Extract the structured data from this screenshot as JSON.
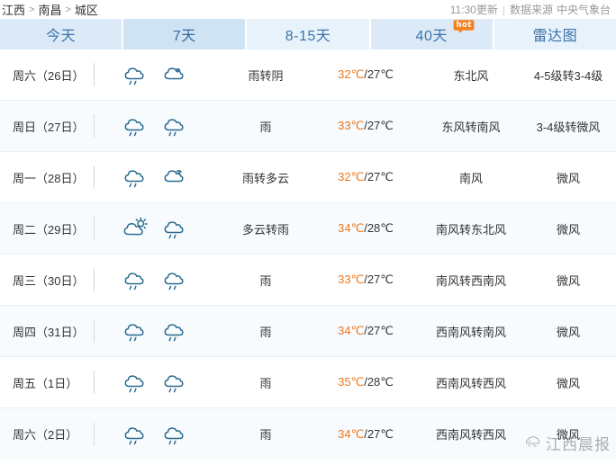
{
  "header": {
    "breadcrumb": [
      "江西",
      "南昌",
      "城区"
    ],
    "separator": ">",
    "update_time": "11:30更新",
    "divider": "|",
    "source_label": "数据来源",
    "source_name": "中央气象台"
  },
  "tabs": [
    {
      "label": "今天",
      "active": false,
      "style": "normal",
      "badge": null
    },
    {
      "label": "7天",
      "active": true,
      "style": "normal",
      "badge": null
    },
    {
      "label": "8-15天",
      "active": false,
      "style": "light",
      "badge": null
    },
    {
      "label": "40天",
      "active": false,
      "style": "normal",
      "badge": "hot"
    },
    {
      "label": "雷达图",
      "active": false,
      "style": "light",
      "badge": null
    }
  ],
  "colors": {
    "tab_bg": "#dceaf7",
    "tab_active_bg": "#cfe3f5",
    "tab_light_bg": "#e8f2fb",
    "tab_text": "#3b73a8",
    "hot_badge": "#f4811f",
    "high_temp": "#f0761a",
    "low_temp": "#333333",
    "icon": "#2a6b8f",
    "row_alt_bg": "#f7fbfe"
  },
  "forecast": [
    {
      "day": "周六（26日）",
      "icons": [
        "rain",
        "cloudy-night"
      ],
      "condition": "雨转阴",
      "high": "32℃",
      "low": "27℃",
      "wind": "东北风",
      "level": "4-5级转3-4级"
    },
    {
      "day": "周日（27日）",
      "icons": [
        "rain",
        "rain"
      ],
      "condition": "雨",
      "high": "33℃",
      "low": "27℃",
      "wind": "东风转南风",
      "level": "3-4级转微风"
    },
    {
      "day": "周一（28日）",
      "icons": [
        "rain",
        "partly-cloudy-night"
      ],
      "condition": "雨转多云",
      "high": "32℃",
      "low": "27℃",
      "wind": "南风",
      "level": "微风"
    },
    {
      "day": "周二（29日）",
      "icons": [
        "partly-cloudy-day",
        "rain"
      ],
      "condition": "多云转雨",
      "high": "34℃",
      "low": "28℃",
      "wind": "南风转东北风",
      "level": "微风"
    },
    {
      "day": "周三（30日）",
      "icons": [
        "rain",
        "rain"
      ],
      "condition": "雨",
      "high": "33℃",
      "low": "27℃",
      "wind": "南风转西南风",
      "level": "微风"
    },
    {
      "day": "周四（31日）",
      "icons": [
        "rain",
        "rain"
      ],
      "condition": "雨",
      "high": "34℃",
      "low": "27℃",
      "wind": "西南风转南风",
      "level": "微风"
    },
    {
      "day": "周五（1日）",
      "icons": [
        "rain",
        "rain"
      ],
      "condition": "雨",
      "high": "35℃",
      "low": "28℃",
      "wind": "西南风转西风",
      "level": "微风"
    },
    {
      "day": "周六（2日）",
      "icons": [
        "rain",
        "rain"
      ],
      "condition": "雨",
      "high": "34℃",
      "low": "27℃",
      "wind": "西南风转西风",
      "level": "微风"
    }
  ],
  "watermark": {
    "text": "江西晨报",
    "icon": "bird-logo"
  },
  "temp_slash": "/"
}
